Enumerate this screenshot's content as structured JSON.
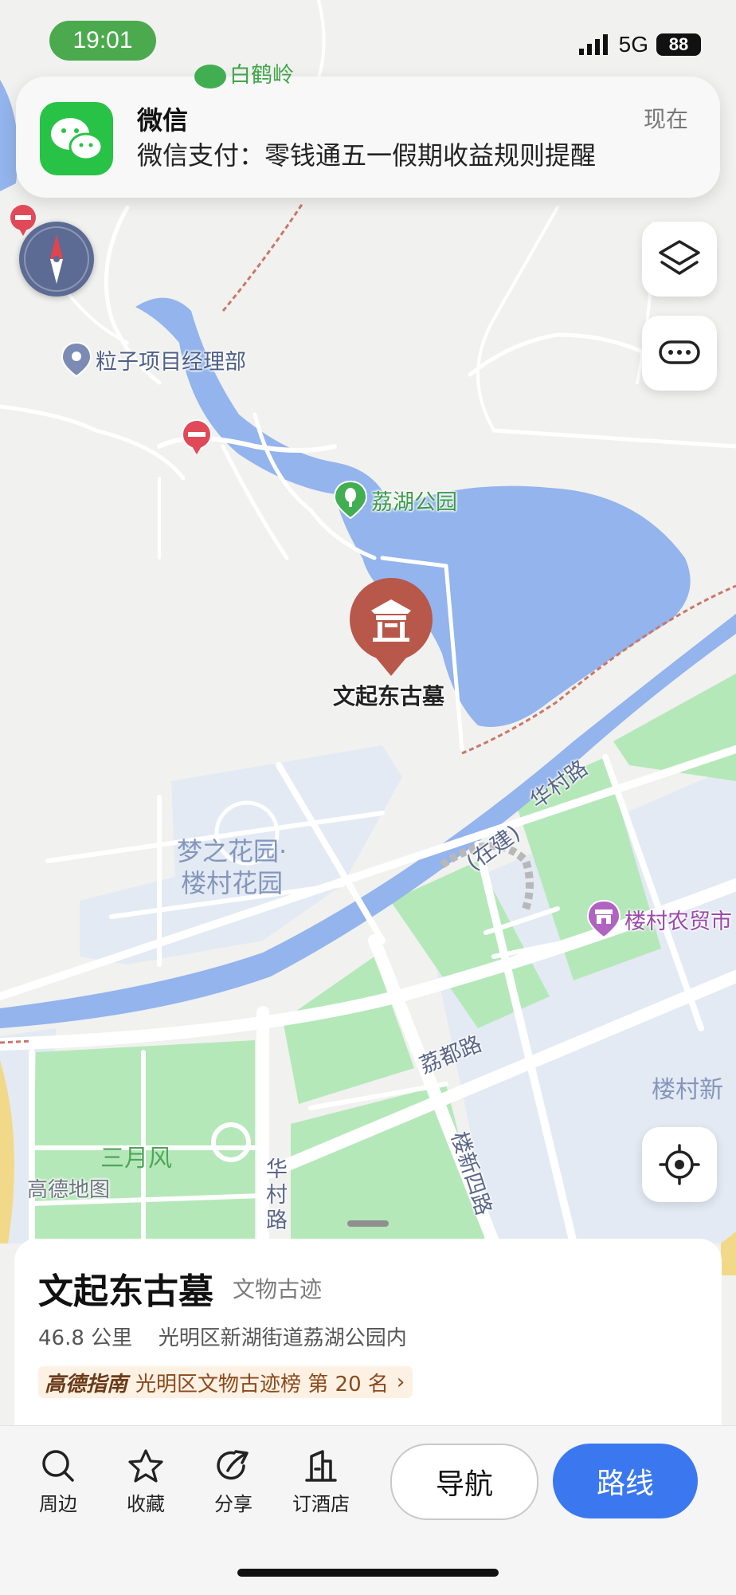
{
  "status_bar": {
    "time": "19:01",
    "network": "5G",
    "battery": "88"
  },
  "notification": {
    "app": "微信",
    "time": "现在",
    "message": "微信支付：零钱通五一假期收益规则提醒"
  },
  "map": {
    "labels": {
      "top_label": "白鹤岭",
      "office": "粒子项目经理部",
      "park": "荔湖公园",
      "selected_poi": "文起东古墓",
      "estate_line1": "梦之花园·",
      "estate_line2": "楼村花园",
      "road_huacun_diag": "华村路",
      "construction": "(在建)",
      "market": "楼村农贸市",
      "road_lidu": "荔都路",
      "louxin_area": "楼村新",
      "sanyuefeng": "三月风",
      "road_louxin4": "楼新四路",
      "road_huacun_vertical": "华村路",
      "watermark": "高德地图"
    },
    "icons": [
      "compass-icon",
      "layers-icon",
      "more-icon",
      "locate-icon",
      "no-entry-icon",
      "location-pin-icon",
      "park-tree-icon",
      "heritage-gate-icon",
      "market-icon"
    ]
  },
  "place": {
    "name": "文起东古墓",
    "category": "文物古迹",
    "distance": "46.8 公里",
    "address": "光明区新湖街道荔湖公园内",
    "rank_brand": "高德指南",
    "rank_text": "光明区文物古迹榜  第 20 名",
    "rank_chevron": "›"
  },
  "toolbar": {
    "nearby": "周边",
    "favorite": "收藏",
    "share": "分享",
    "hotel": "订酒店",
    "navigate": "导航",
    "route": "路线"
  },
  "colors": {
    "water": "#93b4ec",
    "green": "#b5e8b9",
    "urban": "#e3eaf4",
    "background": "#f1f1ef",
    "poi_marker": "#b8584a",
    "route_button": "#3b78f0",
    "wechat": "#28c346"
  }
}
